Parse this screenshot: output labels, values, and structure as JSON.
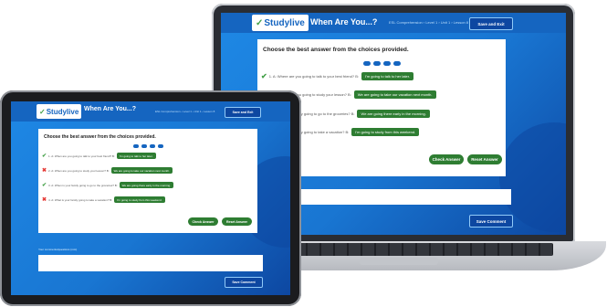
{
  "app": {
    "logo": "Studylive",
    "title": "When Are You...?",
    "breadcrumb": "ESL Comprehension › Level 1 › Unit 1 › Lesson 8",
    "save_exit": "Save and Exit",
    "prompt": "Choose the best answer from the choices provided.",
    "questions": [
      {
        "q": "1. A: When are you going to talk to your best friend? B:",
        "a": "I'm going to talk to her later.",
        "status": "correct"
      },
      {
        "q": "2. A: When are you going to study your lesson? B:",
        "a": "We are going to take our vacation next month.",
        "status": "wrong"
      },
      {
        "q": "3. A: When is your family going to go to the groceries? B:",
        "a": "We are going there early in the morning.",
        "status": "correct"
      },
      {
        "q": "4. A: What is your family going to take a vacation? B:",
        "a": "I'm going to study from this weekend.",
        "status": "wrong"
      }
    ],
    "check_answer": "Check Answer",
    "reset_answer": "Reset Answer",
    "comment_label": "Your comments/questions (mm)",
    "save_comment": "Save Comment"
  },
  "laptop_questions": [
    {
      "q": "1. A: Where are you going to talk to your best friend? B:",
      "a": "I'm going to talk to her later.",
      "status": "correct"
    },
    {
      "q": "2. A: Where are you going to study your lesson? B:",
      "a": "We are going to take our vacation next month.",
      "status": "wrong"
    },
    {
      "q": "ily going to go to the groceries? B:",
      "a": "We are going there early in the morning.",
      "status": "none"
    },
    {
      "q": "ily going to take a vacation? B:",
      "a": "I'm going to study from this weekend.",
      "status": "none"
    }
  ],
  "icons": {
    "correct": "check-icon",
    "wrong": "x-icon",
    "logo": "leaf-icon"
  },
  "colors": {
    "primary": "#1565c0",
    "accent_green": "#2e7d32",
    "error": "#e53935"
  }
}
